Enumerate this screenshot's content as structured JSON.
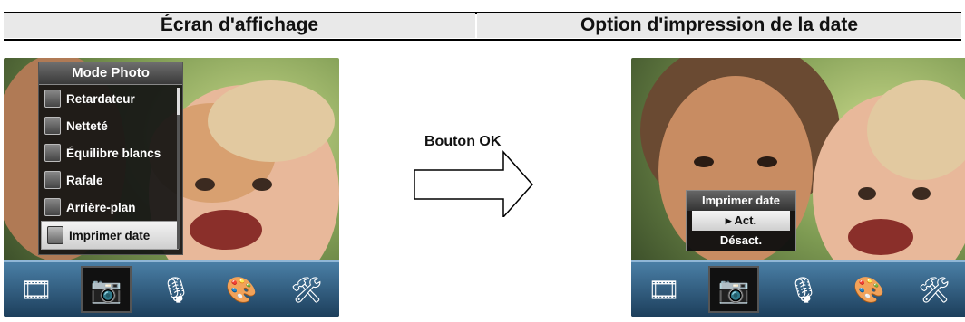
{
  "header": {
    "left_title": "Écran d'affichage",
    "right_title": "Option d'impression de la date"
  },
  "left_screen": {
    "menu": {
      "title": "Mode Photo",
      "items": [
        {
          "label": "Retardateur",
          "icon": "self-timer-icon"
        },
        {
          "label": "Netteté",
          "icon": "sharpness-icon"
        },
        {
          "label": "Équilibre blancs",
          "icon": "white-balance-icon"
        },
        {
          "label": "Rafale",
          "icon": "burst-icon"
        },
        {
          "label": "Arrière-plan",
          "icon": "background-icon"
        },
        {
          "label": "Imprimer date",
          "icon": "date-stamp-icon",
          "selected": true
        }
      ]
    }
  },
  "middle": {
    "button_label": "Bouton OK"
  },
  "right_screen": {
    "popup": {
      "title": "Imprimer date",
      "options": [
        {
          "label": "▸ Act.",
          "selected": true
        },
        {
          "label": "Désact.",
          "selected": false
        }
      ]
    }
  },
  "icon_bar": [
    {
      "icon": "film-reel-icon",
      "glyph": "🎞"
    },
    {
      "icon": "camera-icon",
      "glyph": "📷",
      "active": true
    },
    {
      "icon": "microphone-icon",
      "glyph": "🎙"
    },
    {
      "icon": "palette-icon",
      "glyph": "🎨"
    },
    {
      "icon": "tools-icon",
      "glyph": "🛠"
    }
  ],
  "colors": {
    "iconbar_top": "#4a7fa6",
    "iconbar_bottom": "#1d3f5c",
    "header_bg": "#e9e9e9"
  }
}
